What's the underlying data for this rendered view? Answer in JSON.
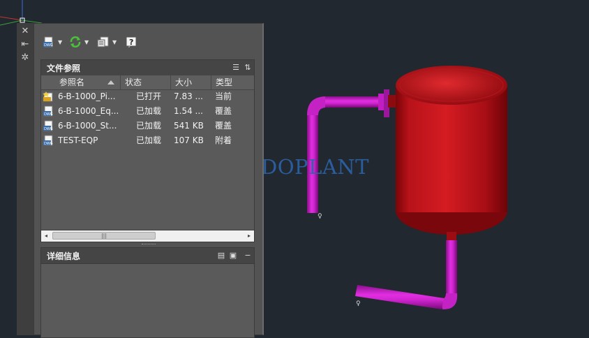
{
  "toolbar": {
    "attach_icon": "attach-dwg-icon",
    "refresh_icon": "refresh-icon",
    "change_path_icon": "change-path-icon",
    "help_icon": "help-icon"
  },
  "side_strip": {
    "close_glyph": "✕",
    "autohide_glyph": "⇤",
    "properties_glyph": "✲"
  },
  "file_references": {
    "title": "文件参照",
    "columns": [
      "参照名",
      "状态",
      "大小",
      "类型"
    ],
    "rows": [
      {
        "name": "6-B-1000_Pi...",
        "status": "已打开",
        "size": "7.83 ...",
        "type": "当前",
        "icon": "current-drawing-icon"
      },
      {
        "name": "6-B-1000_Eq...",
        "status": "已加载",
        "size": "1.54 ...",
        "type": "覆盖",
        "icon": "xref-dwg-icon"
      },
      {
        "name": "6-B-1000_St...",
        "status": "已加载",
        "size": "541 KB",
        "type": "覆盖",
        "icon": "xref-dwg-icon"
      },
      {
        "name": "TEST-EQP",
        "status": "已加载",
        "size": "107 KB",
        "type": "附着",
        "icon": "xref-dwg-icon"
      }
    ],
    "scroll_left": "◂",
    "scroll_thumb_grip": "|||",
    "scroll_right": "▸"
  },
  "details": {
    "title": "详细信息",
    "collapse_glyph": "−"
  },
  "watermark": "DODOPLANT",
  "colors": {
    "background": "#212830",
    "palette": "#535353",
    "vessel": "#b0101a",
    "pipe": "#cc1fcc",
    "watermark": "#2d63a8"
  }
}
